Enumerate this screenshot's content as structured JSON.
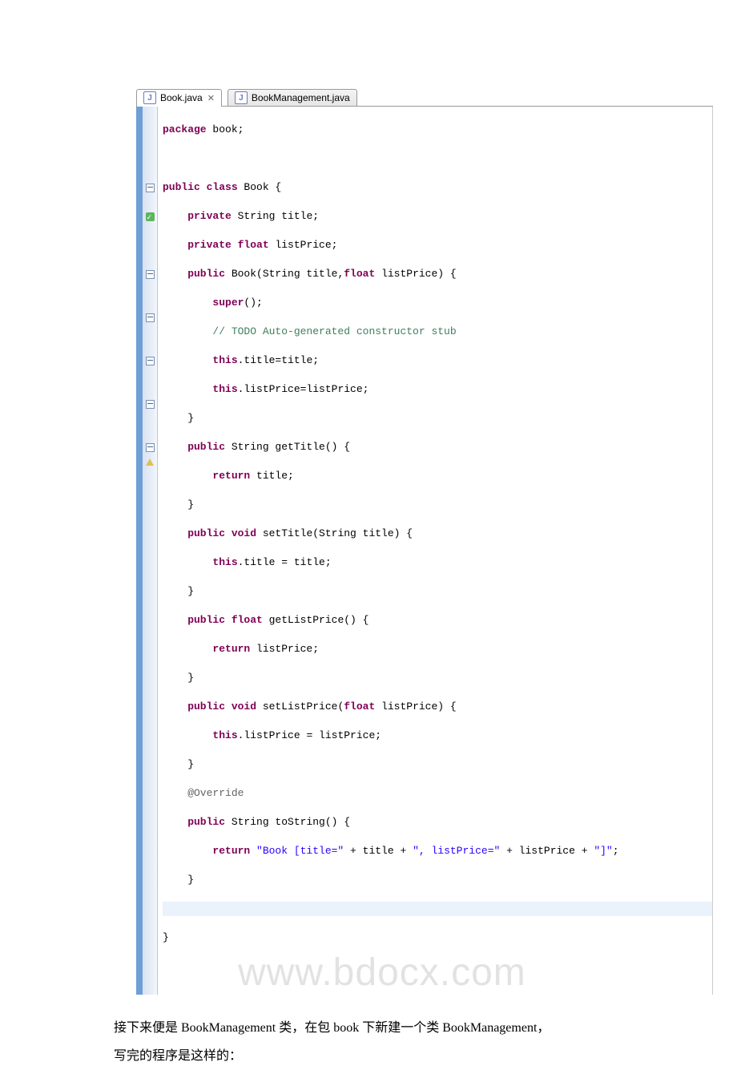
{
  "tabs": [
    {
      "label": "Book.java",
      "active": true,
      "closeable": true
    },
    {
      "label": "BookManagement.java",
      "active": false,
      "closeable": false
    }
  ],
  "gutter_rows": [
    "",
    "",
    "",
    "",
    "",
    "fold",
    "",
    "fix",
    "",
    "",
    "",
    "fold",
    "",
    "",
    "fold",
    "",
    "",
    "fold",
    "",
    "",
    "fold",
    "",
    "",
    "fold",
    "warn",
    "",
    "",
    "",
    "",
    ""
  ],
  "code": {
    "l1": "package",
    "l1b": " book;",
    "l2": "",
    "l3a": "public",
    "l3b": " class",
    "l3c": " Book {",
    "l4a": "    private",
    "l4b": " String title;",
    "l5a": "    private",
    "l5b": " float",
    "l5c": " listPrice;",
    "l6a": "    public",
    "l6b": " Book(String title,",
    "l6c": "float",
    "l6d": " listPrice) {",
    "l7a": "        super",
    "l7b": "();",
    "l8a": "        // TODO Auto-generated constructor stub",
    "l9a": "        this",
    "l9b": ".title=title;",
    "l10a": "        this",
    "l10b": ".listPrice=listPrice;",
    "l11": "    }",
    "l12a": "    public",
    "l12b": " String getTitle() {",
    "l13a": "        return",
    "l13b": " title;",
    "l14": "    }",
    "l15a": "    public",
    "l15b": " void",
    "l15c": " setTitle(String title) {",
    "l16a": "        this",
    "l16b": ".title = title;",
    "l17": "    }",
    "l18a": "    public",
    "l18b": " float",
    "l18c": " getListPrice() {",
    "l19a": "        return",
    "l19b": " listPrice;",
    "l20": "    }",
    "l21a": "    public",
    "l21b": " void",
    "l21c": " setListPrice(",
    "l21d": "float",
    "l21e": " listPrice) {",
    "l22a": "        this",
    "l22b": ".listPrice = listPrice;",
    "l23": "    }",
    "l24a": "    @Override",
    "l25a": "    public",
    "l25b": " String toString() {",
    "l26a": "        return",
    "l26b": " \"Book [title=\"",
    "l26c": " + title + ",
    "l26d": "\", listPrice=\"",
    "l26e": " + listPrice + ",
    "l26f": "\"]\"",
    "l26g": ";",
    "l27": "    }",
    "l28": "",
    "l29": ""
  },
  "watermark": "www.bdocx.com",
  "body_text": {
    "p1": "接下来便是 BookManagement 类，在包 book 下新建一个类 BookManagement，",
    "p2": "写完的程序是这样的："
  }
}
